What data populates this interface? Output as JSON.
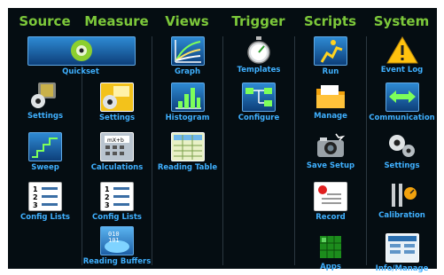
{
  "columns": {
    "source": "Source",
    "measure": "Measure",
    "views": "Views",
    "trigger": "Trigger",
    "scripts": "Scripts",
    "system": "System"
  },
  "source": {
    "quickset": "Quickset",
    "settings": "Settings",
    "sweep": "Sweep",
    "config_lists": "Config Lists"
  },
  "measure": {
    "settings": "Settings",
    "calculations": "Calculations",
    "config_lists": "Config Lists",
    "reading_buffers": "Reading Buffers"
  },
  "views": {
    "graph": "Graph",
    "histogram": "Histogram",
    "reading_table": "Reading Table"
  },
  "trigger": {
    "templates": "Templates",
    "configure": "Configure"
  },
  "scripts": {
    "run": "Run",
    "manage": "Manage",
    "save_setup": "Save Setup",
    "record": "Record",
    "apps": "Apps"
  },
  "system": {
    "event_log": "Event Log",
    "communication": "Communication",
    "settings": "Settings",
    "calibration": "Calibration",
    "info_manage": "Info/Manage"
  },
  "colors": {
    "background": "#050d12",
    "title": "#7cc83a",
    "label": "#3fb0ff"
  }
}
